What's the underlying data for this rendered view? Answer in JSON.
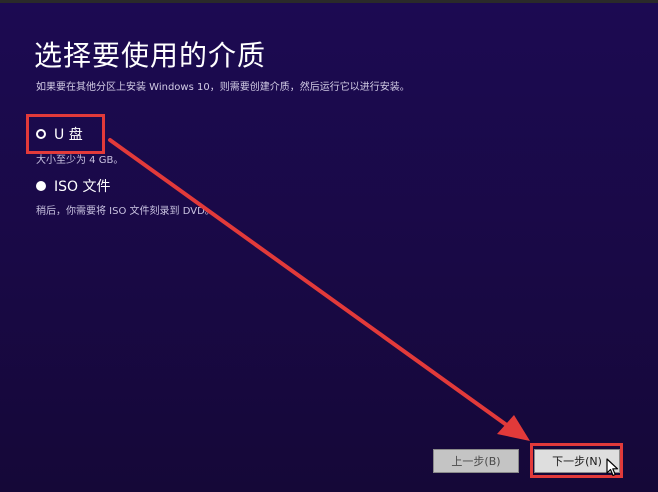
{
  "header": {
    "title": "选择要使用的介质",
    "subtitle": "如果要在其他分区上安装 Windows 10，则需要创建介质，然后运行它以进行安装。"
  },
  "options": [
    {
      "label": "U 盘",
      "hint": "大小至少为 4 GB。",
      "selected": true
    },
    {
      "label": "ISO 文件",
      "hint": "稍后，你需要将 ISO 文件刻录到 DVD。",
      "selected": false
    }
  ],
  "footer": {
    "back_label": "上一步(B)",
    "next_label": "下一步(N)"
  },
  "colors": {
    "background": "#1c0a52",
    "annotation": "#e23a3a"
  },
  "icons": {
    "cursor": "mouse-pointer-icon"
  }
}
